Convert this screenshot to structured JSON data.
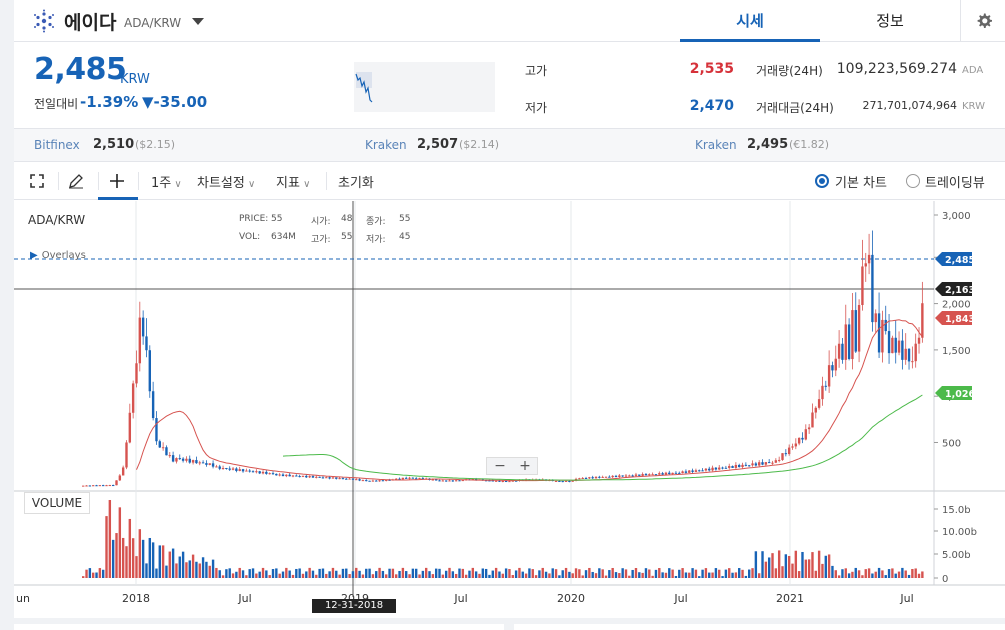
{
  "header": {
    "coin_name": "에이다",
    "pair": "ADA/KRW",
    "tabs": [
      {
        "label": "시세",
        "active": true
      },
      {
        "label": "정보",
        "active": false
      }
    ],
    "accent_color": "#1763b6"
  },
  "summary": {
    "price": "2,485",
    "unit": "KRW",
    "change_label": "전일대비",
    "change_pct": "-1.39%",
    "change_abs": "▼-35.00",
    "high_label": "고가",
    "high_value": "2,535",
    "low_label": "저가",
    "low_value": "2,470",
    "volume_label": "거래량(24H)",
    "volume_value": "109,223,569.274",
    "volume_unit": "ADA",
    "amount_label": "거래대금(24H)",
    "amount_value": "271,701,074,964",
    "amount_unit": "KRW"
  },
  "exchanges": [
    {
      "name": "Bitfinex",
      "price": "2,510",
      "diff": "($2.15)"
    },
    {
      "name": "Kraken",
      "price": "2,507",
      "diff": "($2.14)"
    },
    {
      "name": "Kraken",
      "price": "2,495",
      "diff": "(€1.82)"
    }
  ],
  "toolbar": {
    "period": "1주",
    "chart_settings": "차트설정",
    "indicators": "지표",
    "reset": "초기화",
    "basic_chart": "기본 차트",
    "trading_view": "트레이딩뷰"
  },
  "chart": {
    "symbol": "ADA/KRW",
    "overlays_label": "Overlays",
    "ohlc": {
      "price_label": "PRICE:",
      "price_value": "55",
      "open_label": "시가:",
      "open_value": "48",
      "close_label": "종가:",
      "close_value": "55",
      "vol_label": "VOL:",
      "vol_value": "634M",
      "high_label": "고가:",
      "high_value": "55",
      "low_label": "저가:",
      "low_value": "45"
    },
    "volume_button": "VOLUME",
    "crosshair_date": "12-31-2018",
    "price_axis_ticks": [
      "3,000",
      "2,500",
      "2,000",
      "1,500",
      "1,000",
      "500"
    ],
    "volume_axis_ticks": [
      "15.0b",
      "10.00b",
      "5.00b",
      "0"
    ],
    "x_axis_ticks": [
      "un",
      "2018",
      "Jul",
      "2019",
      "Jul",
      "2020",
      "Jul",
      "2021",
      "Jul"
    ],
    "price_tags": [
      {
        "label": "2,485",
        "color": "#1763b6"
      },
      {
        "label": "2,163",
        "color": "#222222"
      },
      {
        "label": "1,843",
        "color": "#d6534f"
      },
      {
        "label": "1,026",
        "color": "#4cba4a"
      }
    ],
    "up_color": "#d6534f",
    "down_color": "#1763b6",
    "ma_short_color": "#d6534f",
    "ma_long_color": "#4cba4a"
  }
}
